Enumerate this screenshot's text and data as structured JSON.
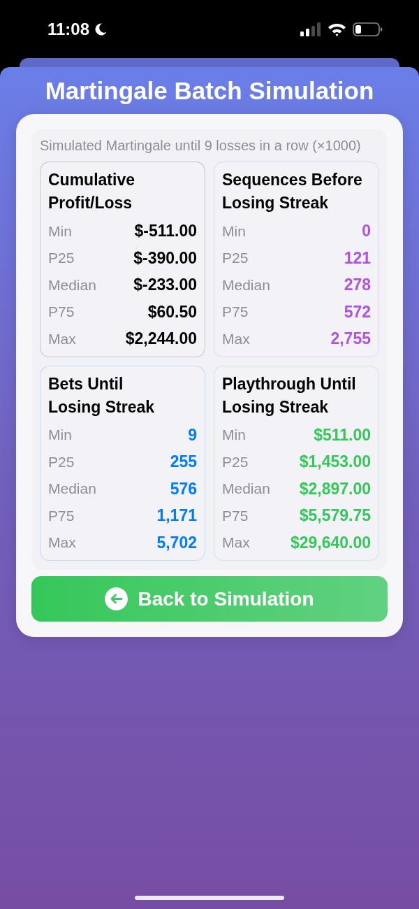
{
  "status_bar": {
    "time": "11:08"
  },
  "title": "Martingale Batch Simulation",
  "subtitle": "Simulated Martingale until 9 losses in a row (×1000)",
  "cards": [
    {
      "title": "Cumulative Profit/Loss",
      "color": "#000000",
      "rows": [
        {
          "label": "Min",
          "value": "$-511.00"
        },
        {
          "label": "P25",
          "value": "$-390.00"
        },
        {
          "label": "Median",
          "value": "$-233.00"
        },
        {
          "label": "P75",
          "value": "$60.50"
        },
        {
          "label": "Max",
          "value": "$2,244.00"
        }
      ]
    },
    {
      "title": "Sequences Before Losing Streak",
      "color": "#af52de",
      "rows": [
        {
          "label": "Min",
          "value": "0"
        },
        {
          "label": "P25",
          "value": "121"
        },
        {
          "label": "Median",
          "value": "278"
        },
        {
          "label": "P75",
          "value": "572"
        },
        {
          "label": "Max",
          "value": "2,755"
        }
      ]
    },
    {
      "title": "Bets Until Losing Streak",
      "color": "#007aff",
      "rows": [
        {
          "label": "Min",
          "value": "9"
        },
        {
          "label": "P25",
          "value": "255"
        },
        {
          "label": "Median",
          "value": "576"
        },
        {
          "label": "P75",
          "value": "1,171"
        },
        {
          "label": "Max",
          "value": "5,702"
        }
      ]
    },
    {
      "title": "Playthrough Until Losing Streak",
      "color": "#34c759",
      "rows": [
        {
          "label": "Min",
          "value": "$511.00"
        },
        {
          "label": "P25",
          "value": "$1,453.00"
        },
        {
          "label": "Median",
          "value": "$2,897.00"
        },
        {
          "label": "P75",
          "value": "$5,579.75"
        },
        {
          "label": "Max",
          "value": "$29,640.00"
        }
      ]
    }
  ],
  "button": {
    "label": "Back to Simulation"
  }
}
